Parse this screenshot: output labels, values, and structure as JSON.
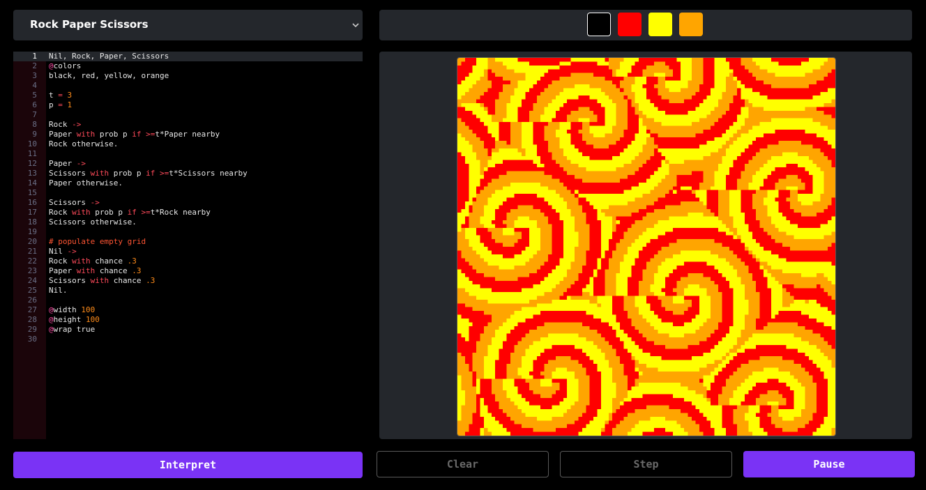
{
  "program_select": {
    "value": "Rock Paper Scissors"
  },
  "palette": {
    "colors": [
      {
        "name": "black",
        "hex": "#000000"
      },
      {
        "name": "red",
        "hex": "#ff0000"
      },
      {
        "name": "yellow",
        "hex": "#ffff00"
      },
      {
        "name": "orange",
        "hex": "#ffa500"
      }
    ]
  },
  "editor": {
    "active_line": 1,
    "lines": [
      "Nil, Rock, Paper, Scissors",
      "@colors",
      "black, red, yellow, orange",
      "",
      "t = 3",
      "p = 1",
      "",
      "Rock ->",
      "Paper with prob p if >=t*Paper nearby",
      "Rock otherwise.",
      "",
      "Paper ->",
      "Scissors with prob p if >=t*Scissors nearby",
      "Paper otherwise.",
      "",
      "Scissors ->",
      "Rock with prob p if >=t*Rock nearby",
      "Scissors otherwise.",
      "",
      "# populate empty grid",
      "Nil ->",
      "Rock with chance .3",
      "Paper with chance .3",
      "Scissors with chance .3",
      "Nil.",
      "",
      "@width 100",
      "@height 100",
      "@wrap true",
      ""
    ]
  },
  "simulation": {
    "width": 100,
    "height": 100,
    "wrap": true
  },
  "buttons": {
    "interpret": "Interpret",
    "clear": "Clear",
    "step": "Step",
    "pause": "Pause"
  },
  "icons": {
    "select_chevron": "chevron-down-icon"
  }
}
